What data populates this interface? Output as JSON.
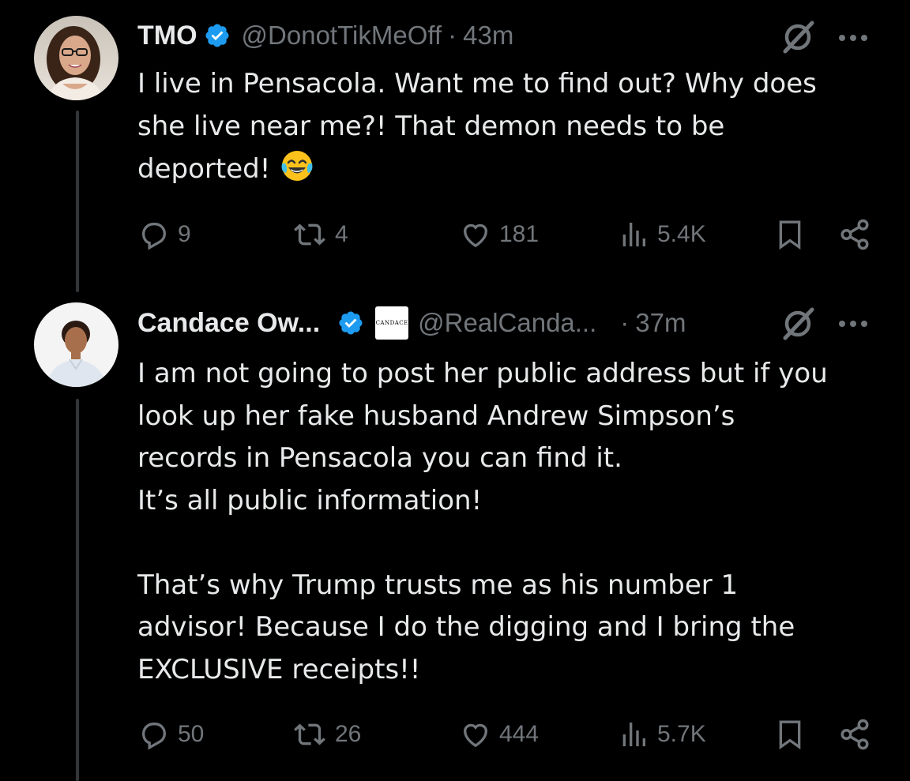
{
  "colors": {
    "background": "#000000",
    "text_primary": "#e7e9ea",
    "text_secondary": "#71767b",
    "verified_blue": "#1d9bf0",
    "thread_line": "#333639"
  },
  "tweets": [
    {
      "display_name": "TMO",
      "verified": true,
      "handle": "@DonotTikMeOff",
      "separator": "·",
      "time": "43m",
      "text_lines": [
        "I live in Pensacola. Want me to find out? Why does",
        "she live near me?! That demon needs to be",
        "deported!"
      ],
      "emoji": "face-with-tears-of-joy",
      "actions": {
        "replies": "9",
        "reposts": "4",
        "likes": "181",
        "views": "5.4K"
      },
      "icons": [
        "grok-icon",
        "more-icon",
        "reply-icon",
        "repost-icon",
        "like-icon",
        "views-icon",
        "bookmark-icon",
        "share-icon"
      ]
    },
    {
      "display_name": "Candace Ow...",
      "verified": true,
      "affiliate_badge_text": "CANDACE",
      "handle": "@RealCanda...",
      "separator": "·",
      "time": "37m",
      "text_lines": [
        "I am not going to post her public address but if you",
        "look up her fake husband Andrew Simpson’s",
        "records in Pensacola you can find it.",
        "It’s all public information!",
        "",
        "That’s why Trump trusts me as his number 1",
        "advisor! Because I do the digging and I bring the",
        "EXCLUSIVE receipts!!"
      ],
      "actions": {
        "replies": "50",
        "reposts": "26",
        "likes": "444",
        "views": "5.7K"
      },
      "icons": [
        "grok-icon",
        "more-icon",
        "reply-icon",
        "repost-icon",
        "like-icon",
        "views-icon",
        "bookmark-icon",
        "share-icon"
      ]
    }
  ]
}
